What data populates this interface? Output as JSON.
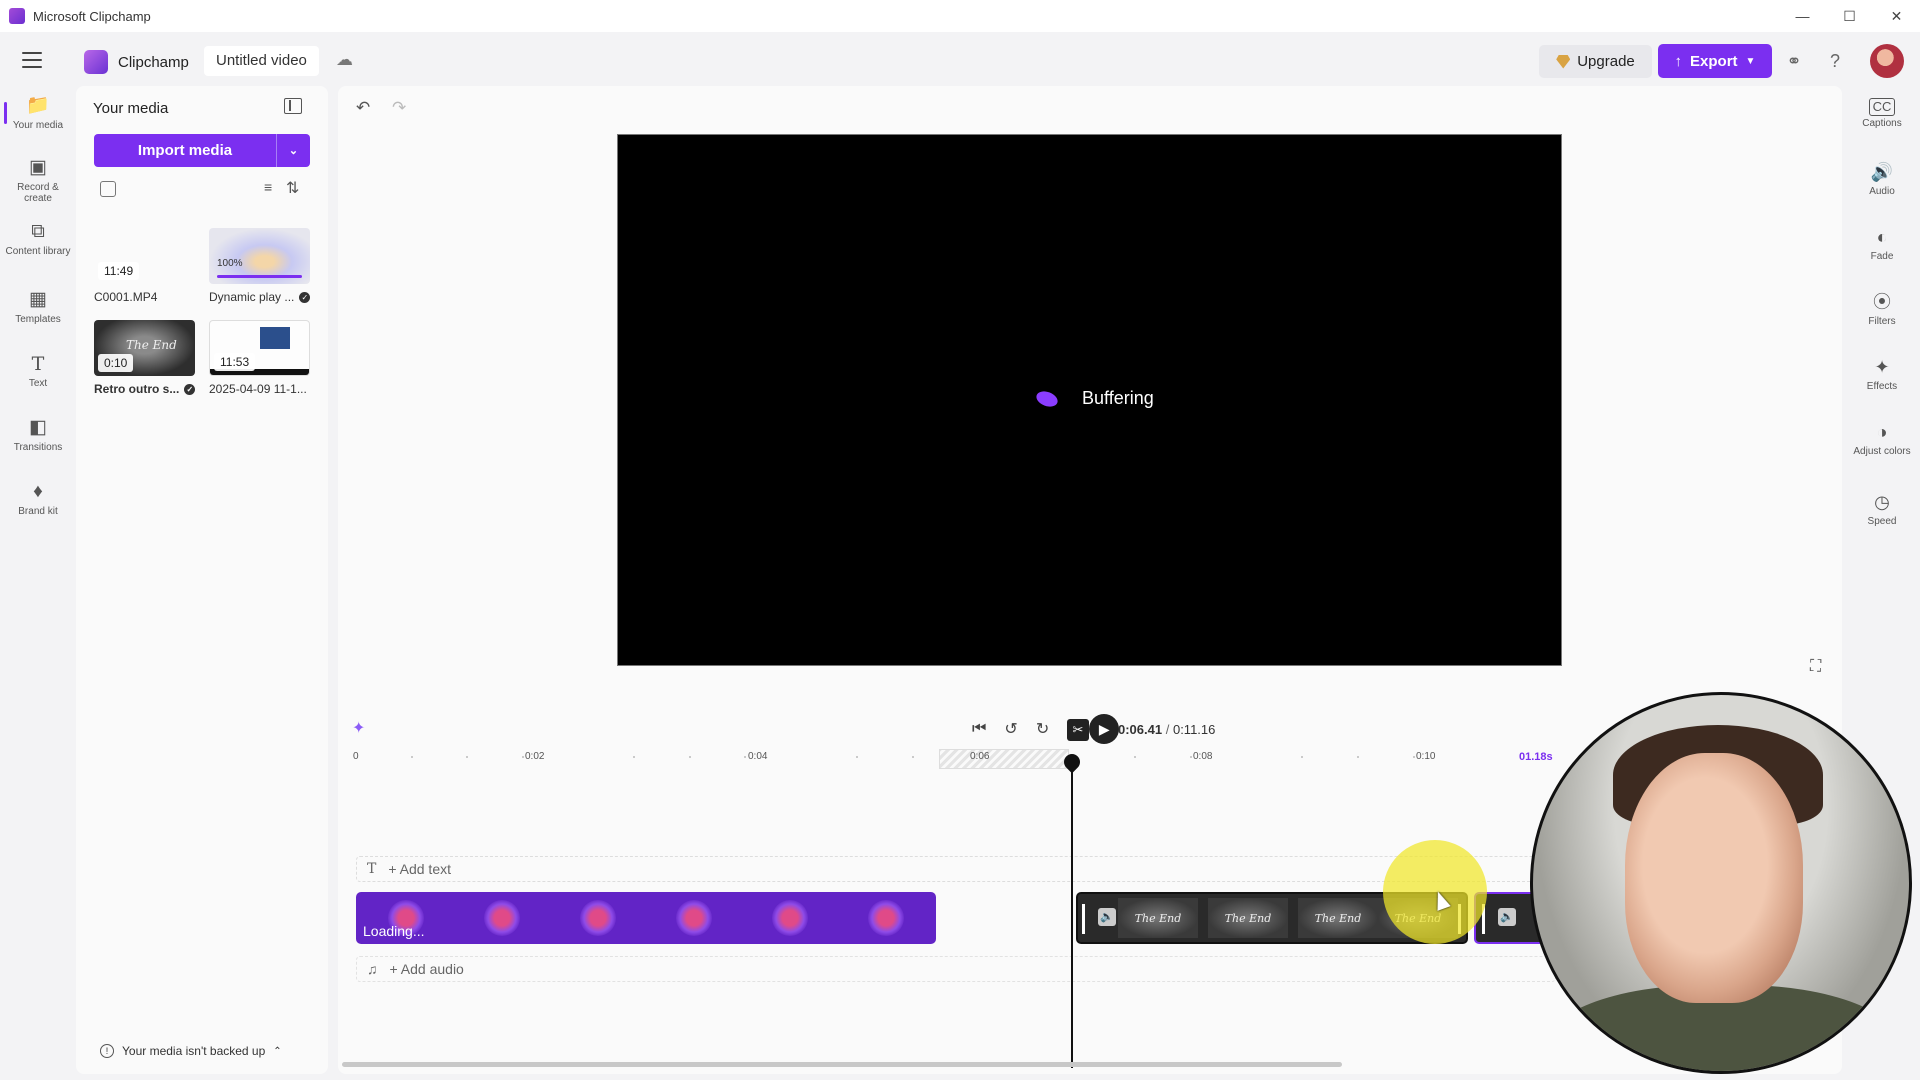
{
  "window": {
    "title": "Microsoft Clipchamp"
  },
  "header": {
    "brand": "Clipchamp",
    "project_title": "Untitled video",
    "upgrade_label": "Upgrade",
    "export_label": "Export"
  },
  "rail": {
    "items": [
      {
        "label": "Your media",
        "icon": "folder-icon"
      },
      {
        "label": "Record & create",
        "icon": "camera-icon"
      },
      {
        "label": "Content library",
        "icon": "library-icon"
      },
      {
        "label": "Templates",
        "icon": "templates-icon"
      },
      {
        "label": "Text",
        "icon": "text-icon"
      },
      {
        "label": "Transitions",
        "icon": "transitions-icon"
      },
      {
        "label": "Brand kit",
        "icon": "brand-kit-icon"
      }
    ]
  },
  "media": {
    "title": "Your media",
    "import_label": "Import media",
    "items": [
      {
        "name": "C0001.MP4",
        "duration": "11:49"
      },
      {
        "name": "Dynamic play ...",
        "badge": "100%"
      },
      {
        "name": "Retro outro s...",
        "duration": "0:10"
      },
      {
        "name": "2025-04-09 11-1...",
        "duration": "11:53"
      }
    ],
    "backup_text": "Your media isn't backed up"
  },
  "preview": {
    "status": "Buffering"
  },
  "playback": {
    "current": "0:06.41",
    "separator": "/",
    "total": "0:11.16"
  },
  "ruler": {
    "labels": [
      "0",
      "0:02",
      "0:04",
      "0:06",
      "0:08",
      "0:10"
    ],
    "end_marker": "01.18s"
  },
  "timeline": {
    "add_text": "+ Add text",
    "add_audio": "+ Add audio",
    "clip1_status": "Loading...",
    "clip2_cell_text": "The End"
  },
  "right_rail": {
    "items": [
      {
        "label": "Captions",
        "icon": "captions-icon"
      },
      {
        "label": "Audio",
        "icon": "speaker-icon"
      },
      {
        "label": "Fade",
        "icon": "fade-icon"
      },
      {
        "label": "Filters",
        "icon": "filters-icon"
      },
      {
        "label": "Effects",
        "icon": "effects-icon"
      },
      {
        "label": "Adjust colors",
        "icon": "adjust-colors-icon"
      },
      {
        "label": "Speed",
        "icon": "speed-icon"
      }
    ]
  },
  "colors": {
    "accent": "#7b2ff0",
    "preview_bg": "#000000"
  }
}
